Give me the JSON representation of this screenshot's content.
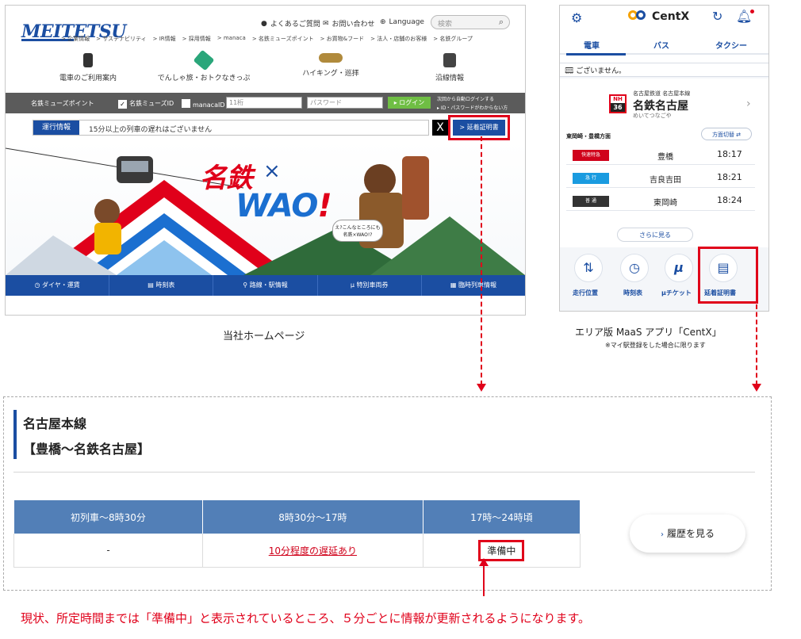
{
  "homepage": {
    "logo": "MEITETSU",
    "utility": {
      "faq": "よくあるご質問",
      "contact": "お問い合わせ",
      "language": "Language"
    },
    "search_placeholder": "検索",
    "nav_links": [
      "> 企業情報",
      "> サステナビリティ",
      "> IR情報",
      "> 採用情報",
      "> manaca",
      "> 名鉄ミューズポイント",
      "> お買物&フード",
      "> 法人・店舗のお客様",
      "> 名鉄グループ"
    ],
    "categories": [
      "電車のご利用案内",
      "でんしゃ旅・おトクなきっぷ",
      "ハイキング・巡拝",
      "沿線情報"
    ],
    "login_bar": {
      "label": "名鉄ミューズポイント",
      "muse_id": "名鉄ミューズID",
      "manaca_id": "manacaID",
      "id_placeholder": "11桁",
      "password_placeholder": "パスワード",
      "login_button": "▸ ログイン",
      "auto_login": "次回から自動ログインする",
      "forgot": "▸ ID・パスワードがわからない方"
    },
    "operation": {
      "label": "運行情報",
      "message": "15分以上の列車の遅れはございません",
      "x_label": "X",
      "delay_cert_button": "> 延着証明書"
    },
    "hero": {
      "title_main": "名鉄",
      "title_x": "×",
      "title_sub": "WAO",
      "title_excl": "!",
      "bubble": "え?こんなところにも名鉄×WAO!?"
    },
    "bottom_nav": [
      "ダイヤ・運賃",
      "時刻表",
      "路線・駅情報",
      "特別車両券",
      "臨時列車情報"
    ]
  },
  "app": {
    "brand": "CentX",
    "tabs": [
      "電車",
      "バス",
      "タクシー"
    ],
    "notice": "ございません。",
    "station": {
      "badge_top": "NH",
      "badge_num": "36",
      "line": "名古屋鉄道 名古屋本線",
      "name": "名鉄名古屋",
      "kana": "めいてつなごや"
    },
    "direction": "東岡崎・豊橋方面",
    "direction_switch": "方面切替 ⇄",
    "departures": [
      {
        "type": "快速特急",
        "color": "#d0021b",
        "dest": "豊橋",
        "time": "18:17"
      },
      {
        "type": "急 行",
        "color": "#1a9be0",
        "dest": "吉良吉田",
        "time": "18:21"
      },
      {
        "type": "普 通",
        "color": "#333333",
        "dest": "東岡崎",
        "time": "18:24"
      }
    ],
    "more": "さらに見る",
    "shortcuts": [
      "走行位置",
      "時刻表",
      "μチケット",
      "延着証明書"
    ]
  },
  "captions": {
    "homepage": "当社ホームページ",
    "app": "エリア版 MaaS アプリ「CentX」",
    "app_note": "※マイ駅登録をした場合に限ります"
  },
  "certificate": {
    "line": "名古屋本線",
    "section": "【豊橋～名鉄名古屋】",
    "headers": [
      "初列車～8時30分",
      "8時30分～17時",
      "17時～24時頃"
    ],
    "values": [
      "-",
      "10分程度の遅延あり",
      "準備中"
    ],
    "history_button": "履歴を見る"
  },
  "note": "現状、所定時間までは「準備中」と表示されているところ、５分ごとに情報が更新されるようになります。"
}
